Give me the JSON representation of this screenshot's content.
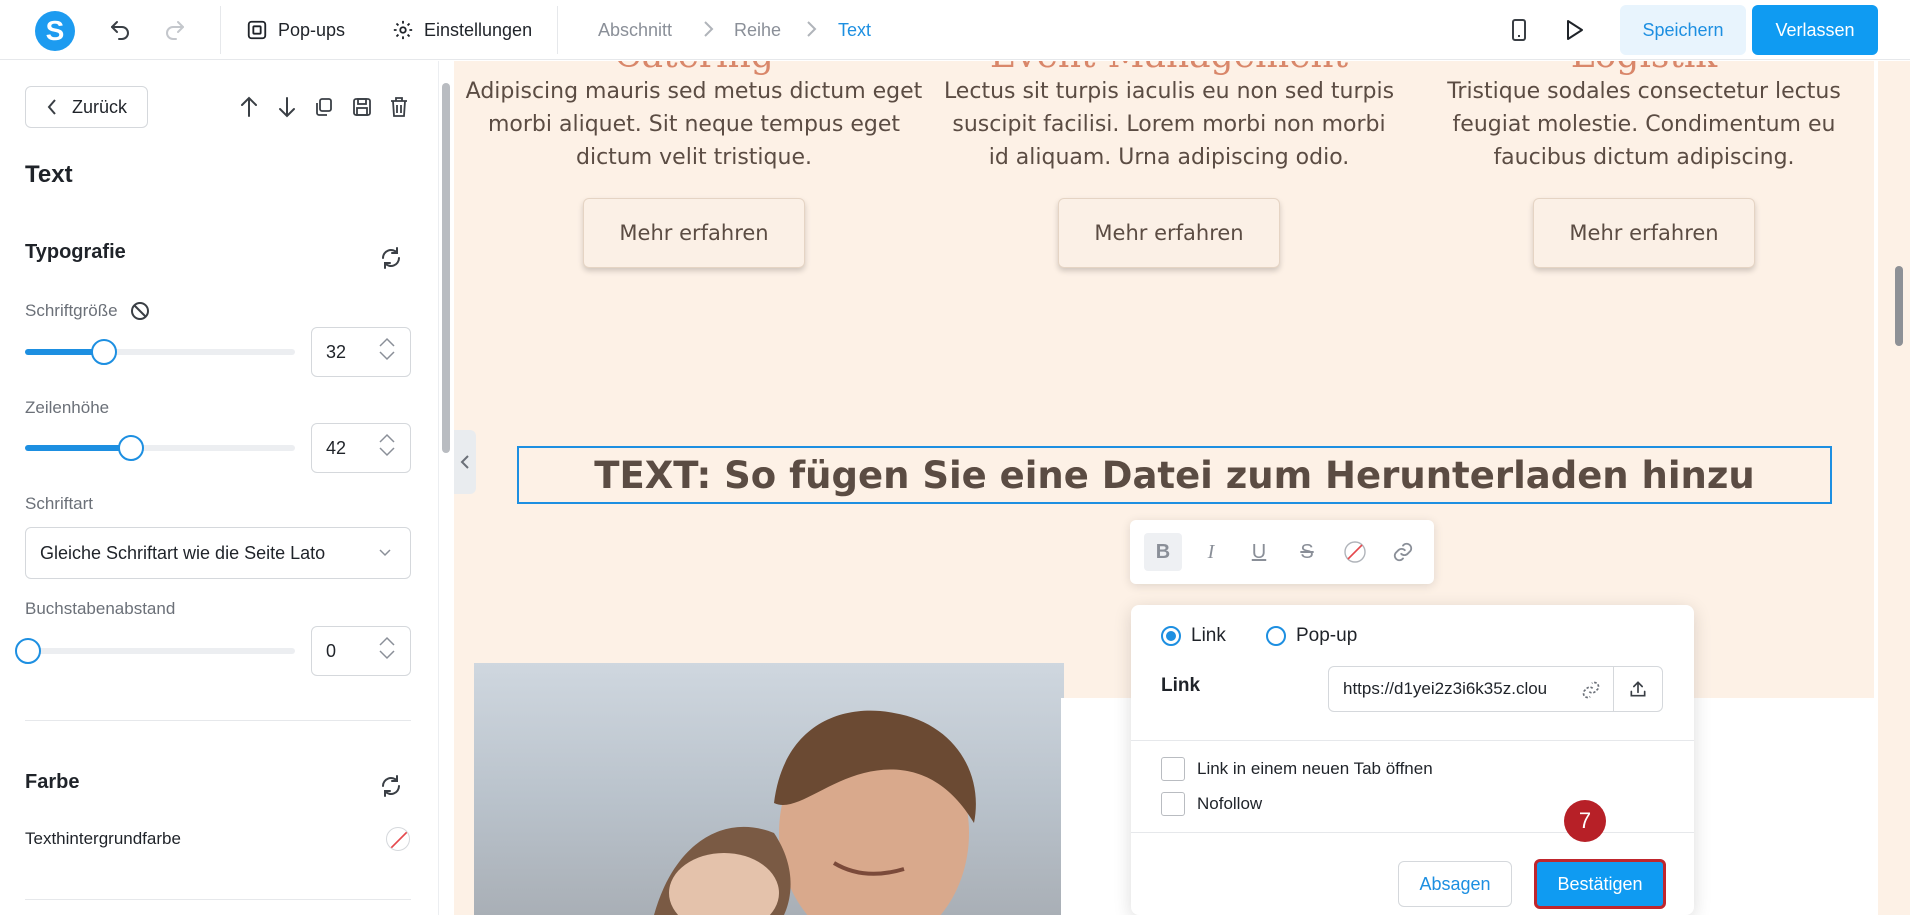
{
  "topbar": {
    "logo_letter": "S",
    "popups_label": "Pop-ups",
    "settings_label": "Einstellungen",
    "breadcrumb": [
      "Abschnitt",
      "Reihe",
      "Text"
    ],
    "save_label": "Speichern",
    "exit_label": "Verlassen"
  },
  "panel": {
    "back_label": "Zurück",
    "title": "Text",
    "typography_title": "Typografie",
    "font_size_label": "Schriftgröße",
    "font_size_value": "32",
    "font_size_fraction": 0.28,
    "line_height_label": "Zeilenhöhe",
    "line_height_value": "42",
    "line_height_fraction": 0.38,
    "font_family_label": "Schriftart",
    "font_family_value": "Gleiche Schriftart wie die Seite Lato",
    "letter_spacing_label": "Buchstabenabstand",
    "letter_spacing_value": "0",
    "letter_spacing_fraction": 0.0,
    "color_title": "Farbe",
    "text_bg_label": "Texthintergrundfarbe"
  },
  "canvas": {
    "services": [
      {
        "title": "Catering",
        "text": "Adipiscing mauris sed metus dictum eget morbi aliquet. Sit neque tempus eget dictum velit tristique.",
        "button": "Mehr erfahren"
      },
      {
        "title": "Event-Management",
        "text": "Lectus sit turpis iaculis eu non sed turpis suscipit facilisi. Lorem morbi non morbi id aliquam. Urna adipiscing odio.",
        "button": "Mehr erfahren"
      },
      {
        "title": "Logistik",
        "text": "Tristique sodales consectetur lectus feugiat molestie. Condimentum eu faucibus dictum adipiscing.",
        "button": "Mehr erfahren"
      }
    ],
    "selected_text": "TEXT: So fügen Sie eine Datei zum Herunterladen hinzu"
  },
  "link_popover": {
    "radio_link": "Link",
    "radio_popup": "Pop-up",
    "link_label": "Link",
    "link_value": "https://d1yei2z3i6k35z.clou",
    "new_tab_label": "Link in einem neuen Tab öffnen",
    "nofollow_label": "Nofollow",
    "cancel_label": "Absagen",
    "confirm_label": "Bestätigen"
  },
  "step_badge": "7",
  "colors": {
    "accent": "#1d8fe1",
    "canvas_bg": "#fdf1e6",
    "heading_salmon": "#d9876a",
    "highlight_red": "#c0262d"
  }
}
